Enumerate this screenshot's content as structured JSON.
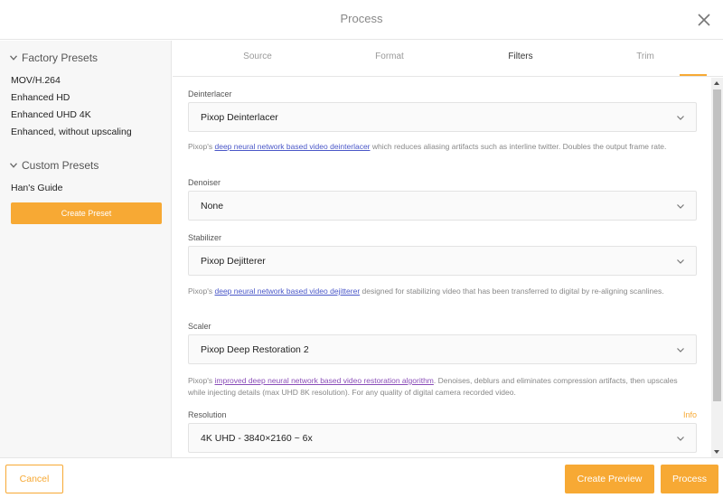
{
  "dialog": {
    "title": "Process"
  },
  "sidebar": {
    "factory_title": "Factory Presets",
    "factory_items": [
      "MOV/H.264",
      "Enhanced HD",
      "Enhanced UHD 4K",
      "Enhanced, without upscaling"
    ],
    "custom_title": "Custom Presets",
    "custom_items": [
      "Han's Guide"
    ],
    "create_label": "Create Preset"
  },
  "tabs": [
    "Source",
    "Format",
    "Filters",
    "Trim"
  ],
  "active_tab": "Filters",
  "filters": {
    "deinterlacer": {
      "label": "Deinterlacer",
      "value": "Pixop Deinterlacer",
      "desc_prefix": "Pixop's ",
      "desc_link": "deep neural network based video deinterlacer",
      "desc_suffix": " which reduces aliasing artifacts such as interline twitter. Doubles the output frame rate."
    },
    "denoiser": {
      "label": "Denoiser",
      "value": "None"
    },
    "stabilizer": {
      "label": "Stabilizer",
      "value": "Pixop Dejitterer",
      "desc_prefix": "Pixop's ",
      "desc_link": "deep neural network based video dejitterer",
      "desc_suffix": " designed for stabilizing video that has been transferred to digital by re-aligning scanlines."
    },
    "scaler": {
      "label": "Scaler",
      "value": "Pixop Deep Restoration 2",
      "desc_prefix": "Pixop's ",
      "desc_link": "improved deep neural network based video restoration algorithm",
      "desc_suffix": ". Denoises, deblurs and eliminates compression artifacts, then upscales while injecting details (max UHD 8K resolution). For any quality of digital camera recorded video."
    },
    "resolution": {
      "label": "Resolution",
      "info": "Info",
      "value": "4K UHD - 3840×2160 ~ 6x"
    }
  },
  "footer": {
    "cancel": "Cancel",
    "preview": "Create Preview",
    "process": "Process"
  },
  "colors": {
    "accent": "#f7a934",
    "link": "#4a57c8",
    "visited_link": "#8a4db8"
  },
  "icons": {
    "close": "close-icon",
    "chevron": "chevron-down-icon"
  }
}
